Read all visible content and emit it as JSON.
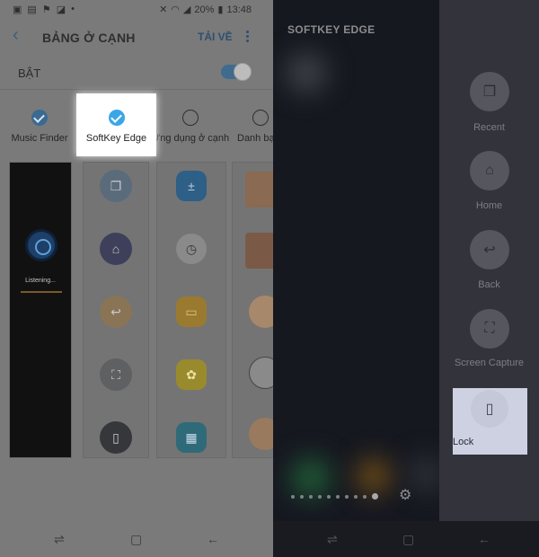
{
  "status": {
    "icons_left": [
      "image-icon",
      "mail-icon",
      "flag-icon",
      "store-icon",
      "more-dots"
    ],
    "battery": "20%",
    "time": "13:48"
  },
  "appbar": {
    "title": "BẢNG Ở CẠNH",
    "action": "TẢI VỀ"
  },
  "toggle_row": {
    "label": "BẬT",
    "on": true
  },
  "panels": [
    {
      "label": "Music Finder",
      "checked": true
    },
    {
      "label": "SoftKey Edge",
      "checked": true
    },
    {
      "label": "Ứng dụng ở cạnh",
      "checked": false
    },
    {
      "label": "Danh bạ",
      "checked": false
    }
  ],
  "music_preview": {
    "text": "Listening..."
  },
  "right": {
    "title": "SOFTKEY EDGE",
    "items": [
      {
        "label": "Recent",
        "icon": "recent-icon"
      },
      {
        "label": "Home",
        "icon": "home-icon"
      },
      {
        "label": "Back",
        "icon": "back-icon"
      },
      {
        "label": "Screen Capture",
        "icon": "screen-capture-icon"
      },
      {
        "label": "Lock",
        "icon": "lock-phone-icon"
      }
    ]
  },
  "colors": {
    "accent": "#3aa6e6",
    "toggle": "#3f6b8e",
    "edge_panel": "#33343b",
    "highlight": "#cdd1e1"
  }
}
